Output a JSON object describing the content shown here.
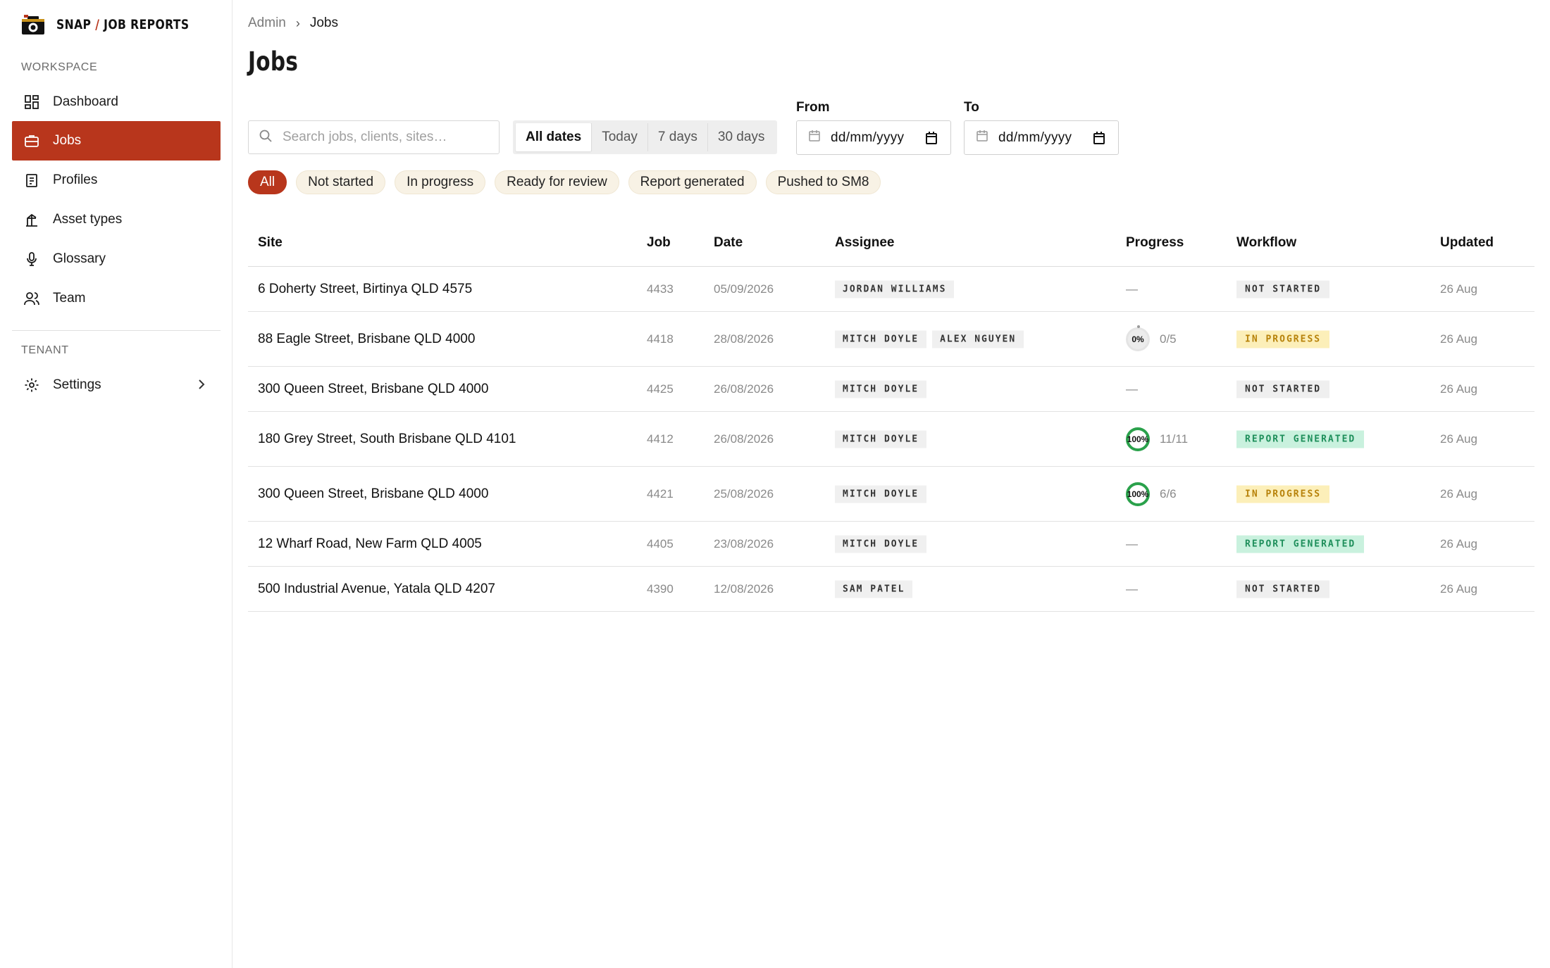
{
  "brand": {
    "name_left": "SNAP",
    "slash": "/",
    "name_right": "JOB REPORTS"
  },
  "sidebar": {
    "workspace_label": "WORKSPACE",
    "items": [
      {
        "label": "Dashboard",
        "icon": "dashboard-icon"
      },
      {
        "label": "Jobs",
        "icon": "briefcase-icon",
        "active": true
      },
      {
        "label": "Profiles",
        "icon": "clipboard-icon"
      },
      {
        "label": "Asset types",
        "icon": "crane-icon"
      },
      {
        "label": "Glossary",
        "icon": "microphone-icon"
      },
      {
        "label": "Team",
        "icon": "users-icon"
      }
    ],
    "tenant_label": "TENANT",
    "settings_label": "Settings"
  },
  "breadcrumb": {
    "root": "Admin",
    "separator": "›",
    "current": "Jobs"
  },
  "page_title": "Jobs",
  "search": {
    "placeholder": "Search jobs, clients, sites…",
    "value": ""
  },
  "date_range": {
    "options": [
      "All dates",
      "Today",
      "7 days",
      "30 days"
    ],
    "selected": "All dates"
  },
  "date_from": {
    "label": "From",
    "placeholder": "dd/mm/yyyy"
  },
  "date_to": {
    "label": "To",
    "placeholder": "dd/mm/yyyy"
  },
  "status_filters": {
    "options": [
      "All",
      "Not started",
      "In progress",
      "Ready for review",
      "Report generated",
      "Pushed to SM8"
    ],
    "selected": "All"
  },
  "table": {
    "columns": {
      "site": "Site",
      "job": "Job",
      "date": "Date",
      "assignee": "Assignee",
      "progress": "Progress",
      "workflow": "Workflow",
      "updated": "Updated"
    },
    "rows": [
      {
        "site": "6 Doherty Street, Birtinya QLD 4575",
        "job": "4433",
        "date": "05/09/2026",
        "assignees": [
          "JORDAN WILLIAMS"
        ],
        "progress_pct": null,
        "progress_text": "—",
        "progress_count": "",
        "workflow": "NOT STARTED",
        "workflow_status": "not-started",
        "updated": "26 Aug"
      },
      {
        "site": "88 Eagle Street, Brisbane QLD 4000",
        "job": "4418",
        "date": "28/08/2026",
        "assignees": [
          "MITCH DOYLE",
          "ALEX NGUYEN"
        ],
        "progress_pct": 0,
        "progress_text": "0%",
        "progress_count": "0/5",
        "workflow": "IN PROGRESS",
        "workflow_status": "in-progress",
        "updated": "26 Aug"
      },
      {
        "site": "300 Queen Street, Brisbane QLD 4000",
        "job": "4425",
        "date": "26/08/2026",
        "assignees": [
          "MITCH DOYLE"
        ],
        "progress_pct": null,
        "progress_text": "—",
        "progress_count": "",
        "workflow": "NOT STARTED",
        "workflow_status": "not-started",
        "updated": "26 Aug"
      },
      {
        "site": "180 Grey Street, South Brisbane QLD 4101",
        "job": "4412",
        "date": "26/08/2026",
        "assignees": [
          "MITCH DOYLE"
        ],
        "progress_pct": 100,
        "progress_text": "100%",
        "progress_count": "11/11",
        "workflow": "REPORT GENERATED",
        "workflow_status": "report-generated",
        "updated": "26 Aug"
      },
      {
        "site": "300 Queen Street, Brisbane QLD 4000",
        "job": "4421",
        "date": "25/08/2026",
        "assignees": [
          "MITCH DOYLE"
        ],
        "progress_pct": 100,
        "progress_text": "100%",
        "progress_count": "6/6",
        "workflow": "IN PROGRESS",
        "workflow_status": "in-progress",
        "updated": "26 Aug"
      },
      {
        "site": "12 Wharf Road, New Farm QLD 4005",
        "job": "4405",
        "date": "23/08/2026",
        "assignees": [
          "MITCH DOYLE"
        ],
        "progress_pct": null,
        "progress_text": "—",
        "progress_count": "",
        "workflow": "REPORT GENERATED",
        "workflow_status": "report-generated",
        "updated": "26 Aug"
      },
      {
        "site": "500 Industrial Avenue, Yatala QLD 4207",
        "job": "4390",
        "date": "12/08/2026",
        "assignees": [
          "SAM PATEL"
        ],
        "progress_pct": null,
        "progress_text": "—",
        "progress_count": "",
        "workflow": "NOT STARTED",
        "workflow_status": "not-started",
        "updated": "26 Aug"
      }
    ]
  },
  "colors": {
    "accent": "#b8361c",
    "chip_bg": "#f8f2e5",
    "progress_ring": "#2aa14b",
    "in_progress_bg": "#fcefb9",
    "report_generated_bg": "#c9f1de"
  }
}
